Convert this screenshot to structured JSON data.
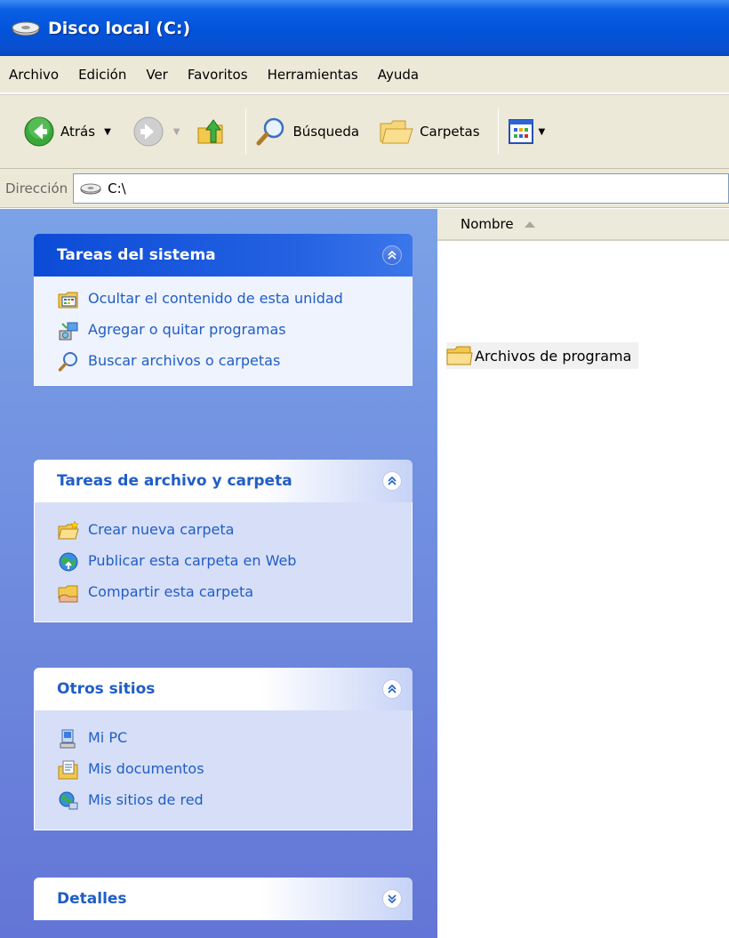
{
  "window": {
    "title": "Disco local (C:)"
  },
  "menu": {
    "items": [
      "Archivo",
      "Edición",
      "Ver",
      "Favoritos",
      "Herramientas",
      "Ayuda"
    ]
  },
  "toolbar": {
    "back_label": "Atrás",
    "search_label": "Búsqueda",
    "folders_label": "Carpetas"
  },
  "address": {
    "label": "Dirección",
    "value": "C:\\"
  },
  "taskpane": {
    "system": {
      "title": "Tareas del sistema",
      "items": [
        "Ocultar el contenido de esta unidad",
        "Agregar o quitar programas",
        "Buscar archivos o carpetas"
      ]
    },
    "file_folder": {
      "title": "Tareas de archivo y carpeta",
      "items": [
        "Crear nueva carpeta",
        "Publicar esta carpeta en Web",
        "Compartir esta carpeta"
      ]
    },
    "other_places": {
      "title": "Otros sitios",
      "items": [
        "Mi PC",
        "Mis documentos",
        "Mis sitios de red"
      ]
    },
    "details": {
      "title": "Detalles"
    }
  },
  "filelist": {
    "column": "Nombre",
    "items": [
      "Archivos de programa"
    ]
  },
  "colors": {
    "titlebar": "#0253d9",
    "taskpane": "#7ba2e7",
    "link": "#215dc6"
  }
}
